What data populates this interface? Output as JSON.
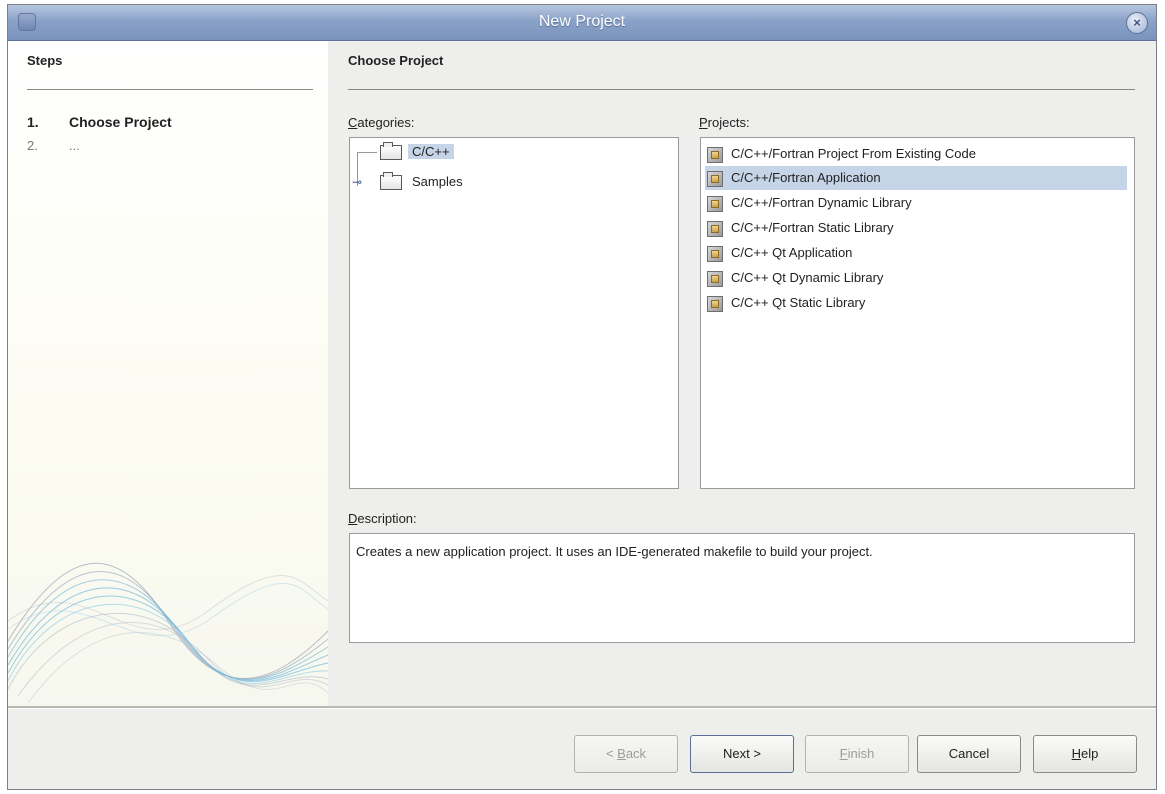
{
  "window": {
    "title": "New Project",
    "close_label": "×"
  },
  "steps": {
    "title": "Steps",
    "items": [
      {
        "num": "1.",
        "label": "Choose Project"
      },
      {
        "num": "2.",
        "label": "..."
      }
    ]
  },
  "main": {
    "title": "Choose Project",
    "categories_label_mnemonic": "C",
    "categories_label_rest": "ategories:",
    "projects_label_mnemonic": "P",
    "projects_label_rest": "rojects:",
    "categories": [
      {
        "label": "C/C++",
        "selected": true
      },
      {
        "label": "Samples",
        "selected": false
      }
    ],
    "projects": [
      {
        "label": "C/C++/Fortran Project From Existing Code",
        "selected": false
      },
      {
        "label": "C/C++/Fortran Application",
        "selected": true
      },
      {
        "label": "C/C++/Fortran Dynamic Library",
        "selected": false
      },
      {
        "label": "C/C++/Fortran Static Library",
        "selected": false
      },
      {
        "label": "C/C++ Qt Application",
        "selected": false
      },
      {
        "label": "C/C++ Qt Dynamic Library",
        "selected": false
      },
      {
        "label": "C/C++ Qt Static Library",
        "selected": false
      }
    ],
    "description_label_mnemonic": "D",
    "description_label_rest": "escription:",
    "description_text": "Creates a new application project. It uses an IDE-generated makefile to build your project."
  },
  "buttons": {
    "back_prefix": "< ",
    "back_mnemonic": "B",
    "back_rest": "ack",
    "next": "Next >",
    "finish_mnemonic": "F",
    "finish_rest": "inish",
    "cancel": "Cancel",
    "help_mnemonic": "H",
    "help_rest": "elp"
  },
  "colors": {
    "selection": "#c6d4e8",
    "titlebar": "#8aa2c8",
    "dialog_bg": "#eeeeec"
  }
}
